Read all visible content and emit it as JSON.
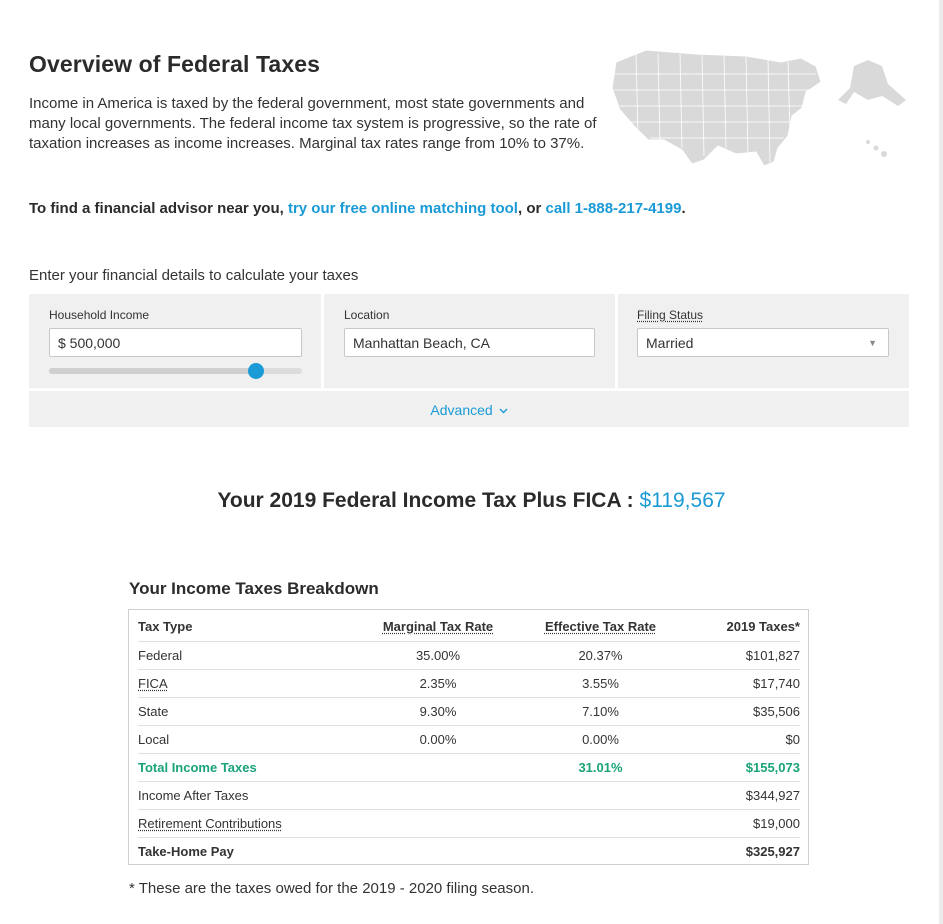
{
  "page": {
    "title": "Overview of Federal Taxes",
    "intro": "Income in America is taxed by the federal government, most state governments and many local governments. The federal income tax system is progressive, so the rate of taxation increases as income increases. Marginal tax rates range from 10% to 37%.",
    "advisor_prefix": "To find a financial advisor near you, ",
    "advisor_link": "try our free online matching tool",
    "advisor_mid": ", or ",
    "advisor_phone": "call 1-888-217-4199",
    "advisor_suffix": "."
  },
  "calculator": {
    "prompt": "Enter your financial details to calculate your taxes",
    "income_label": "Household Income",
    "income_value": "$ 500,000",
    "income_slider_fraction": 0.82,
    "location_label": "Location",
    "location_value": "Manhattan Beach, CA",
    "filing_label": "Filing Status",
    "filing_value": "Married",
    "advanced_label": "Advanced"
  },
  "result": {
    "label": "Your 2019 Federal Income Tax Plus FICA : ",
    "amount": "$119,567"
  },
  "breakdown": {
    "title": "Your Income Taxes Breakdown",
    "headers": {
      "type": "Tax Type",
      "marginal": "Marginal Tax Rate",
      "effective": "Effective Tax Rate",
      "taxes": "2019 Taxes*"
    },
    "rows": [
      {
        "type": "Federal",
        "marginal": "35.00%",
        "effective": "20.37%",
        "taxes": "$101,827"
      },
      {
        "type": "FICA",
        "marginal": "2.35%",
        "effective": "3.55%",
        "taxes": "$17,740"
      },
      {
        "type": "State",
        "marginal": "9.30%",
        "effective": "7.10%",
        "taxes": "$35,506"
      },
      {
        "type": "Local",
        "marginal": "0.00%",
        "effective": "0.00%",
        "taxes": "$0"
      },
      {
        "type": "Total Income Taxes",
        "marginal": "",
        "effective": "31.01%",
        "taxes": "$155,073"
      },
      {
        "type": "Income After Taxes",
        "marginal": "",
        "effective": "",
        "taxes": "$344,927"
      },
      {
        "type": "Retirement Contributions",
        "marginal": "",
        "effective": "",
        "taxes": "$19,000"
      },
      {
        "type": "Take-Home Pay",
        "marginal": "",
        "effective": "",
        "taxes": "$325,927"
      }
    ],
    "footnote": "* These are the taxes owed for the 2019 - 2020 filing season."
  },
  "colors": {
    "accent": "#1a9ad6",
    "total_green": "#1aa37a",
    "panel_bg": "#f0f0f0"
  }
}
